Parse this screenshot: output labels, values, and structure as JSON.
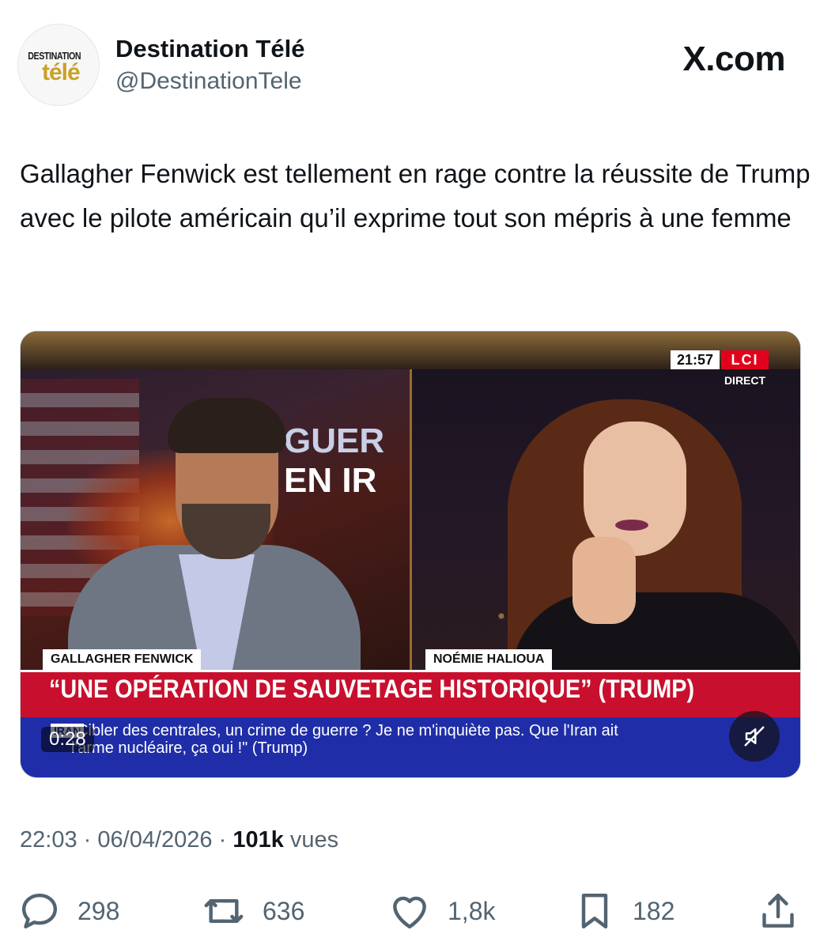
{
  "header": {
    "avatar_logo_top": "DESTINATION",
    "avatar_logo_bottom": "télé",
    "display_name": "Destination Télé",
    "handle": "@DestinationTele",
    "source_site": "X.com"
  },
  "tweet": {
    "text": "Gallagher Fenwick est tellement en rage contre la réussite de Trump avec le pilote américain qu’il exprime tout son mépris à une femme"
  },
  "video": {
    "clock": "21:57",
    "channel": "LCI",
    "live_label": "DIRECT",
    "screen_title_line1": "GUER",
    "screen_title_line2": "EN IR",
    "name_left": "GALLAGHER FENWICK",
    "name_right": "NOÉMIE HALIOUA",
    "headline": "“UNE OPÉRATION DE SAUVETAGE HISTORIQUE” (TRUMP)",
    "tag": "IRAN",
    "subtitle": "\"Cibler des centrales, un crime de guerre ? Je ne m'inquiète pas. Que l'Iran ait l'arme nucléaire, ça oui !\" (Trump)",
    "timestamp": "0:28",
    "mute_icon": "speaker-muted-icon"
  },
  "meta": {
    "time": "22:03",
    "date": "06/04/2026",
    "separator": "·",
    "views_count": "101k",
    "views_label": "vues"
  },
  "actions": {
    "replies": "298",
    "reposts": "636",
    "likes": "1,8k",
    "bookmarks": "182"
  },
  "colors": {
    "text_primary": "#0f1419",
    "text_secondary": "#536471",
    "lci_red": "#e3001b",
    "headline_red": "#c8102e",
    "subtitle_blue": "#1f2ea8",
    "logo_gold": "#c9a227"
  }
}
